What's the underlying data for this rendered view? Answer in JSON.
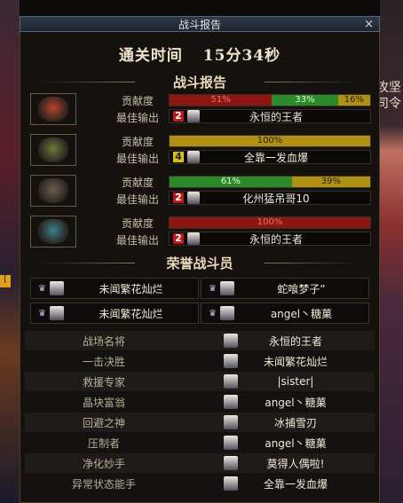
{
  "window": {
    "title": "战斗报告",
    "close": "×"
  },
  "time": {
    "label": "通关时间",
    "value": "15分34秒"
  },
  "section_report": "战斗报告",
  "section_honor": "荣誉战斗员",
  "row_labels": {
    "contribution": "贡献度",
    "best_output": "最佳输出"
  },
  "players": [
    {
      "mask_color": "#b8432b",
      "bar": [
        {
          "pct": 51,
          "color": "red",
          "label": "51%"
        },
        {
          "pct": 33,
          "color": "green",
          "label": "33%"
        },
        {
          "pct": 16,
          "color": "gold",
          "label": "16%"
        }
      ],
      "rank": "2",
      "rank_color": "r2",
      "best": "永恒的王者"
    },
    {
      "mask_color": "#6a7a3a",
      "bar": [
        {
          "pct": 100,
          "color": "gold",
          "label": "100%"
        }
      ],
      "rank": "4",
      "rank_color": "r4",
      "best": "全靠一发血爆"
    },
    {
      "mask_color": "#6a6050",
      "bar": [
        {
          "pct": 61,
          "color": "green",
          "label": "61%"
        },
        {
          "pct": 39,
          "color": "gold",
          "label": "39%"
        }
      ],
      "rank": "2",
      "rank_color": "r2",
      "best": "化州猛吊哥10"
    },
    {
      "mask_color": "#3a7f8a",
      "bar": [
        {
          "pct": 100,
          "color": "red",
          "label": "100%"
        }
      ],
      "rank": "2",
      "rank_color": "r2",
      "best": "永恒的王者"
    }
  ],
  "honor": [
    {
      "name": "未闻繁花灿烂"
    },
    {
      "name": "蛇喰梦子”"
    },
    {
      "name": "未闻繁花灿烂"
    },
    {
      "name": "angel丶糖菓"
    }
  ],
  "awards": [
    {
      "title": "战场名将",
      "name": "永恒的王者"
    },
    {
      "title": "一击决胜",
      "name": "未闻繁花灿烂"
    },
    {
      "title": "救援专家",
      "name": "|sister|"
    },
    {
      "title": "晶块富翁",
      "name": "angel丶糖菓"
    },
    {
      "title": "回避之神",
      "name": "冰捕雪刃"
    },
    {
      "title": "压制者",
      "name": "angel丶糖菓"
    },
    {
      "title": "净化妙手",
      "name": "莫得人偶啦!"
    },
    {
      "title": "异常状态能手",
      "name": "全靠一发血爆"
    }
  ],
  "background": {
    "right_text": "攻坚\n司令",
    "left_badge": "["
  }
}
